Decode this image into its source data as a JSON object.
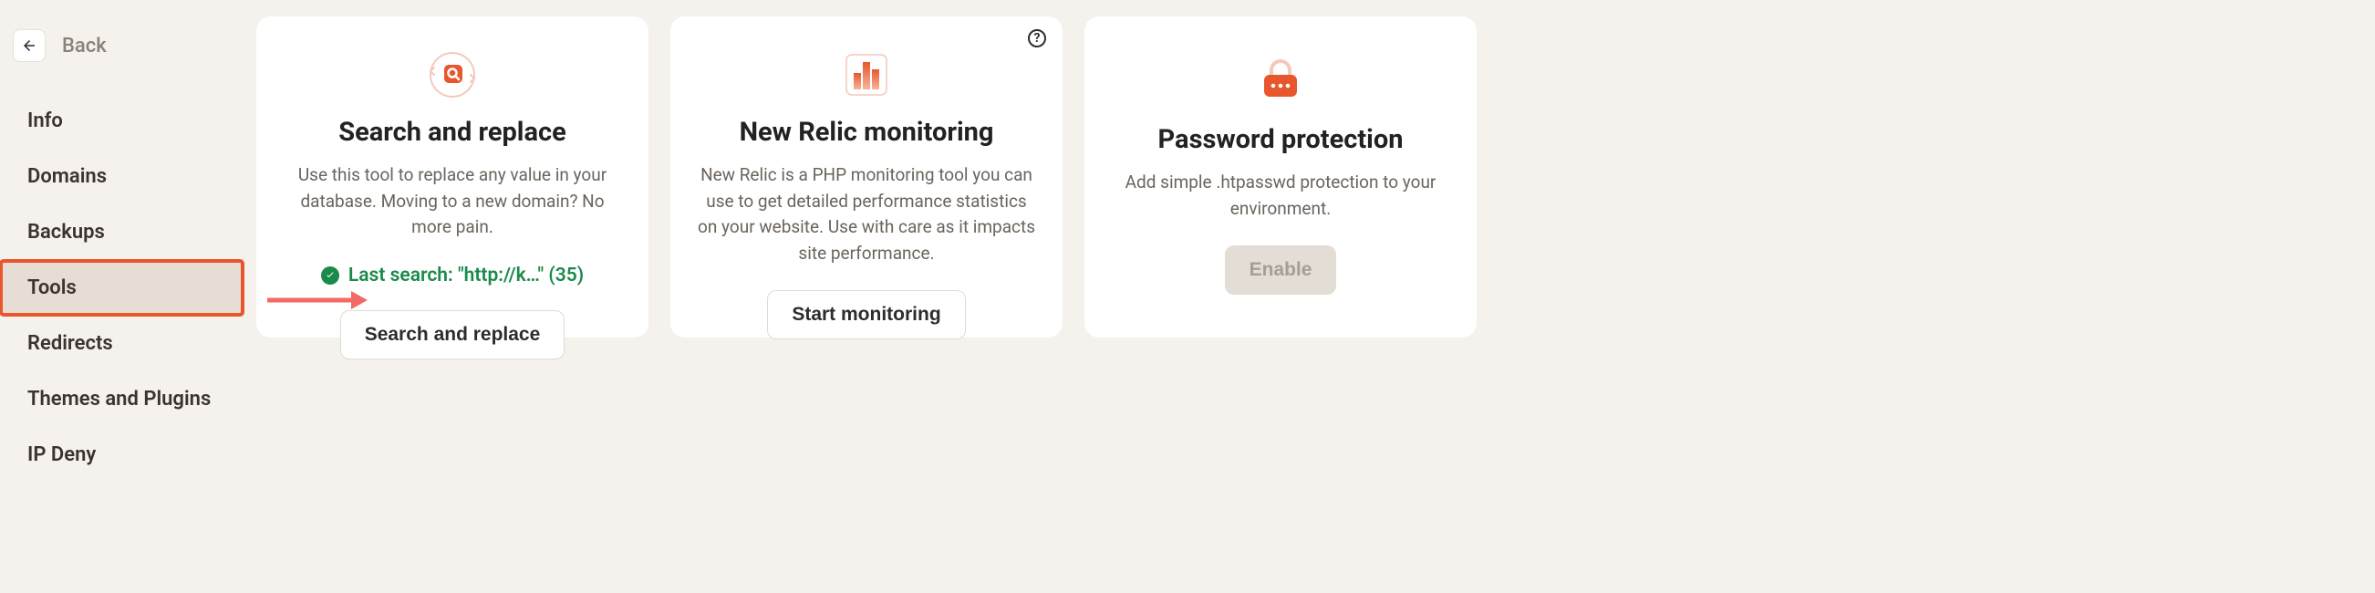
{
  "back_label": "Back",
  "nav": {
    "items": [
      {
        "label": "Info"
      },
      {
        "label": "Domains"
      },
      {
        "label": "Backups"
      },
      {
        "label": "Tools",
        "active": true
      },
      {
        "label": "Redirects"
      },
      {
        "label": "Themes and Plugins"
      },
      {
        "label": "IP Deny"
      }
    ]
  },
  "cards": {
    "search_replace": {
      "title": "Search and replace",
      "description": "Use this tool to replace any value in your database. Moving to a new domain? No more pain.",
      "status": "Last search: \"http://k…\" (35)",
      "button": "Search and replace"
    },
    "new_relic": {
      "title": "New Relic monitoring",
      "description": "New Relic is a PHP monitoring tool you can use to get detailed performance statistics on your website. Use with care as it impacts site performance.",
      "button": "Start monitoring"
    },
    "password_protection": {
      "title": "Password protection",
      "description": "Add simple .htpasswd protection to your environment.",
      "button": "Enable"
    }
  },
  "colors": {
    "accent": "#e8572b",
    "success": "#1a8a4a"
  }
}
